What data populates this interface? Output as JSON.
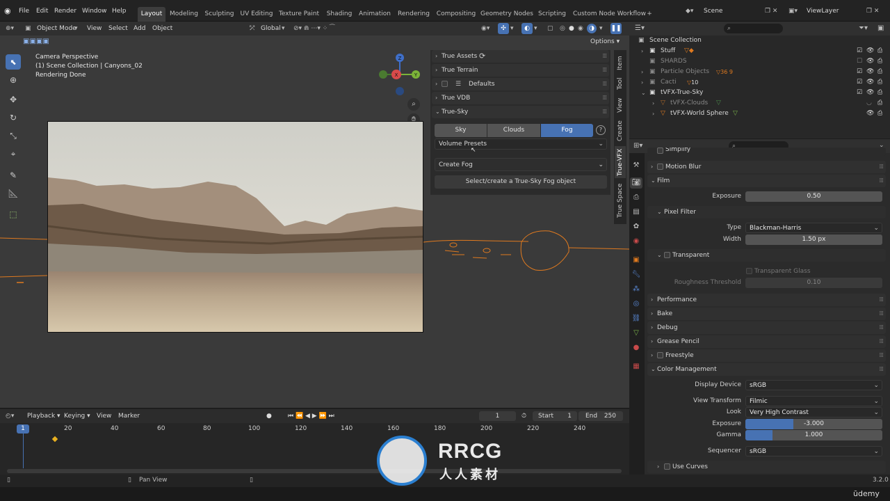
{
  "menu": [
    "File",
    "Edit",
    "Render",
    "Window",
    "Help"
  ],
  "workspaces": [
    "Layout",
    "Modeling",
    "Sculpting",
    "UV Editing",
    "Texture Paint",
    "Shading",
    "Animation",
    "Rendering",
    "Compositing",
    "Geometry Nodes",
    "Scripting",
    "Custom Node Workflow"
  ],
  "scene": {
    "name": "Scene",
    "view_layer": "ViewLayer"
  },
  "viewport_header": {
    "mode": "Object Mode",
    "menus": [
      "View",
      "Select",
      "Add",
      "Object"
    ],
    "orientation": "Global",
    "options": "Options"
  },
  "overlay": {
    "line1": "Camera Perspective",
    "line2": "(1) Scene Collection | Canyons_02",
    "line3": "Rendering Done"
  },
  "gizmo": {
    "z": "Z",
    "x": "X",
    "y": "Y"
  },
  "npanel": {
    "rows": [
      {
        "label": "True Assets"
      },
      {
        "label": "True Terrain"
      },
      {
        "label": "Defaults"
      },
      {
        "label": "True VDB"
      },
      {
        "label": "True-Sky"
      }
    ],
    "tabs": [
      "Sky",
      "Clouds",
      "Fog"
    ],
    "active_tab": "Fog",
    "help": "?",
    "volume_presets": "Volume Presets",
    "create_fog": "Create Fog",
    "select_create": "Select/create a True-Sky Fog object"
  },
  "side_tabs": [
    "Item",
    "Tool",
    "View",
    "Create",
    "True-VFX",
    "True Space"
  ],
  "outliner": {
    "root": "Scene Collection",
    "items": [
      {
        "name": "Stuff"
      },
      {
        "name": "SHARDS"
      },
      {
        "name": "Particle Objects",
        "badge": "36 9"
      },
      {
        "name": "Cacti",
        "badge": "10"
      },
      {
        "name": "tVFX-True-Sky"
      },
      {
        "name": "tVFX-Clouds"
      },
      {
        "name": "tVFX-World Sphere"
      }
    ]
  },
  "props": {
    "simplify": "Simplify",
    "motion_blur": "Motion Blur",
    "film": "Film",
    "exposure_label": "Exposure",
    "exposure": "0.50",
    "pixel_filter": "Pixel Filter",
    "type_label": "Type",
    "type": "Blackman-Harris",
    "width_label": "Width",
    "width": "1.50 px",
    "transparent": "Transparent",
    "transparent_glass": "Transparent Glass",
    "roughness_label": "Roughness Threshold",
    "roughness": "0.10",
    "performance": "Performance",
    "bake": "Bake",
    "debug": "Debug",
    "grease_pencil": "Grease Pencil",
    "freestyle": "Freestyle",
    "color_management": "Color Management",
    "display_device_label": "Display Device",
    "display_device": "sRGB",
    "view_transform_label": "View Transform",
    "view_transform": "Filmic",
    "look_label": "Look",
    "look": "Very High Contrast",
    "cm_exposure_label": "Exposure",
    "cm_exposure": "-3.000",
    "cm_exposure_fill": 0.35,
    "gamma_label": "Gamma",
    "gamma": "1.000",
    "gamma_fill": 0.2,
    "sequencer_label": "Sequencer",
    "sequencer": "sRGB",
    "use_curves": "Use Curves"
  },
  "timeline": {
    "menus": [
      "Playback",
      "Keying",
      "View",
      "Marker"
    ],
    "current_frame": "1",
    "start_label": "Start",
    "start": "1",
    "end_label": "End",
    "end": "250",
    "ticks": [
      "1",
      "20",
      "40",
      "60",
      "80",
      "100",
      "120",
      "140",
      "160",
      "180",
      "200",
      "220",
      "240"
    ]
  },
  "status": {
    "pan": "Pan View",
    "version": "3.2.0"
  },
  "watermark": {
    "brand": "RRCG",
    "sub": "人人素材"
  },
  "udemy": "ūdemy",
  "colors": {
    "accent": "#4772b3",
    "orange": "#e07a1f",
    "green": "#7ab34a"
  }
}
